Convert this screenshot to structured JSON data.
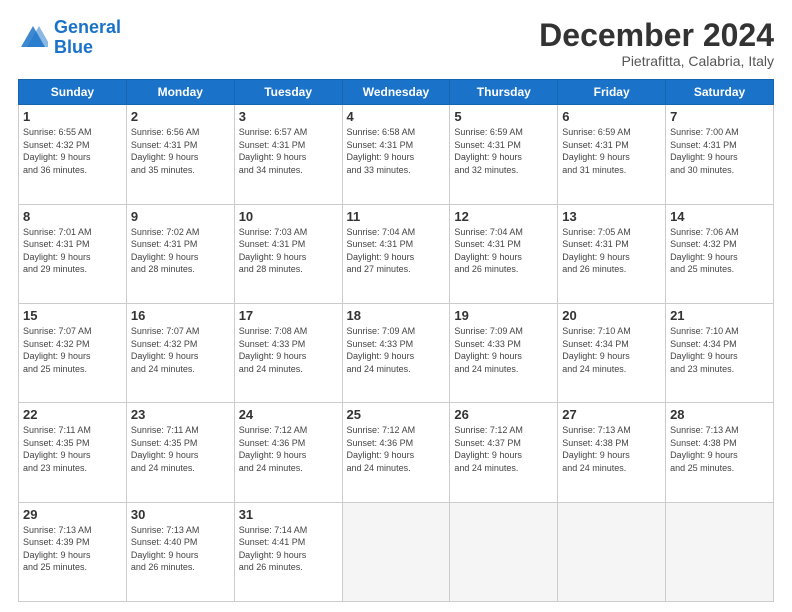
{
  "logo": {
    "text_general": "General",
    "text_blue": "Blue"
  },
  "header": {
    "month": "December 2024",
    "location": "Pietrafitta, Calabria, Italy"
  },
  "weekdays": [
    "Sunday",
    "Monday",
    "Tuesday",
    "Wednesday",
    "Thursday",
    "Friday",
    "Saturday"
  ],
  "weeks": [
    [
      {
        "day": "1",
        "info": "Sunrise: 6:55 AM\nSunset: 4:32 PM\nDaylight: 9 hours\nand 36 minutes."
      },
      {
        "day": "2",
        "info": "Sunrise: 6:56 AM\nSunset: 4:31 PM\nDaylight: 9 hours\nand 35 minutes."
      },
      {
        "day": "3",
        "info": "Sunrise: 6:57 AM\nSunset: 4:31 PM\nDaylight: 9 hours\nand 34 minutes."
      },
      {
        "day": "4",
        "info": "Sunrise: 6:58 AM\nSunset: 4:31 PM\nDaylight: 9 hours\nand 33 minutes."
      },
      {
        "day": "5",
        "info": "Sunrise: 6:59 AM\nSunset: 4:31 PM\nDaylight: 9 hours\nand 32 minutes."
      },
      {
        "day": "6",
        "info": "Sunrise: 6:59 AM\nSunset: 4:31 PM\nDaylight: 9 hours\nand 31 minutes."
      },
      {
        "day": "7",
        "info": "Sunrise: 7:00 AM\nSunset: 4:31 PM\nDaylight: 9 hours\nand 30 minutes."
      }
    ],
    [
      {
        "day": "8",
        "info": "Sunrise: 7:01 AM\nSunset: 4:31 PM\nDaylight: 9 hours\nand 29 minutes."
      },
      {
        "day": "9",
        "info": "Sunrise: 7:02 AM\nSunset: 4:31 PM\nDaylight: 9 hours\nand 28 minutes."
      },
      {
        "day": "10",
        "info": "Sunrise: 7:03 AM\nSunset: 4:31 PM\nDaylight: 9 hours\nand 28 minutes."
      },
      {
        "day": "11",
        "info": "Sunrise: 7:04 AM\nSunset: 4:31 PM\nDaylight: 9 hours\nand 27 minutes."
      },
      {
        "day": "12",
        "info": "Sunrise: 7:04 AM\nSunset: 4:31 PM\nDaylight: 9 hours\nand 26 minutes."
      },
      {
        "day": "13",
        "info": "Sunrise: 7:05 AM\nSunset: 4:31 PM\nDaylight: 9 hours\nand 26 minutes."
      },
      {
        "day": "14",
        "info": "Sunrise: 7:06 AM\nSunset: 4:32 PM\nDaylight: 9 hours\nand 25 minutes."
      }
    ],
    [
      {
        "day": "15",
        "info": "Sunrise: 7:07 AM\nSunset: 4:32 PM\nDaylight: 9 hours\nand 25 minutes."
      },
      {
        "day": "16",
        "info": "Sunrise: 7:07 AM\nSunset: 4:32 PM\nDaylight: 9 hours\nand 24 minutes."
      },
      {
        "day": "17",
        "info": "Sunrise: 7:08 AM\nSunset: 4:33 PM\nDaylight: 9 hours\nand 24 minutes."
      },
      {
        "day": "18",
        "info": "Sunrise: 7:09 AM\nSunset: 4:33 PM\nDaylight: 9 hours\nand 24 minutes."
      },
      {
        "day": "19",
        "info": "Sunrise: 7:09 AM\nSunset: 4:33 PM\nDaylight: 9 hours\nand 24 minutes."
      },
      {
        "day": "20",
        "info": "Sunrise: 7:10 AM\nSunset: 4:34 PM\nDaylight: 9 hours\nand 24 minutes."
      },
      {
        "day": "21",
        "info": "Sunrise: 7:10 AM\nSunset: 4:34 PM\nDaylight: 9 hours\nand 23 minutes."
      }
    ],
    [
      {
        "day": "22",
        "info": "Sunrise: 7:11 AM\nSunset: 4:35 PM\nDaylight: 9 hours\nand 23 minutes."
      },
      {
        "day": "23",
        "info": "Sunrise: 7:11 AM\nSunset: 4:35 PM\nDaylight: 9 hours\nand 24 minutes."
      },
      {
        "day": "24",
        "info": "Sunrise: 7:12 AM\nSunset: 4:36 PM\nDaylight: 9 hours\nand 24 minutes."
      },
      {
        "day": "25",
        "info": "Sunrise: 7:12 AM\nSunset: 4:36 PM\nDaylight: 9 hours\nand 24 minutes."
      },
      {
        "day": "26",
        "info": "Sunrise: 7:12 AM\nSunset: 4:37 PM\nDaylight: 9 hours\nand 24 minutes."
      },
      {
        "day": "27",
        "info": "Sunrise: 7:13 AM\nSunset: 4:38 PM\nDaylight: 9 hours\nand 24 minutes."
      },
      {
        "day": "28",
        "info": "Sunrise: 7:13 AM\nSunset: 4:38 PM\nDaylight: 9 hours\nand 25 minutes."
      }
    ],
    [
      {
        "day": "29",
        "info": "Sunrise: 7:13 AM\nSunset: 4:39 PM\nDaylight: 9 hours\nand 25 minutes."
      },
      {
        "day": "30",
        "info": "Sunrise: 7:13 AM\nSunset: 4:40 PM\nDaylight: 9 hours\nand 26 minutes."
      },
      {
        "day": "31",
        "info": "Sunrise: 7:14 AM\nSunset: 4:41 PM\nDaylight: 9 hours\nand 26 minutes."
      },
      null,
      null,
      null,
      null
    ]
  ]
}
